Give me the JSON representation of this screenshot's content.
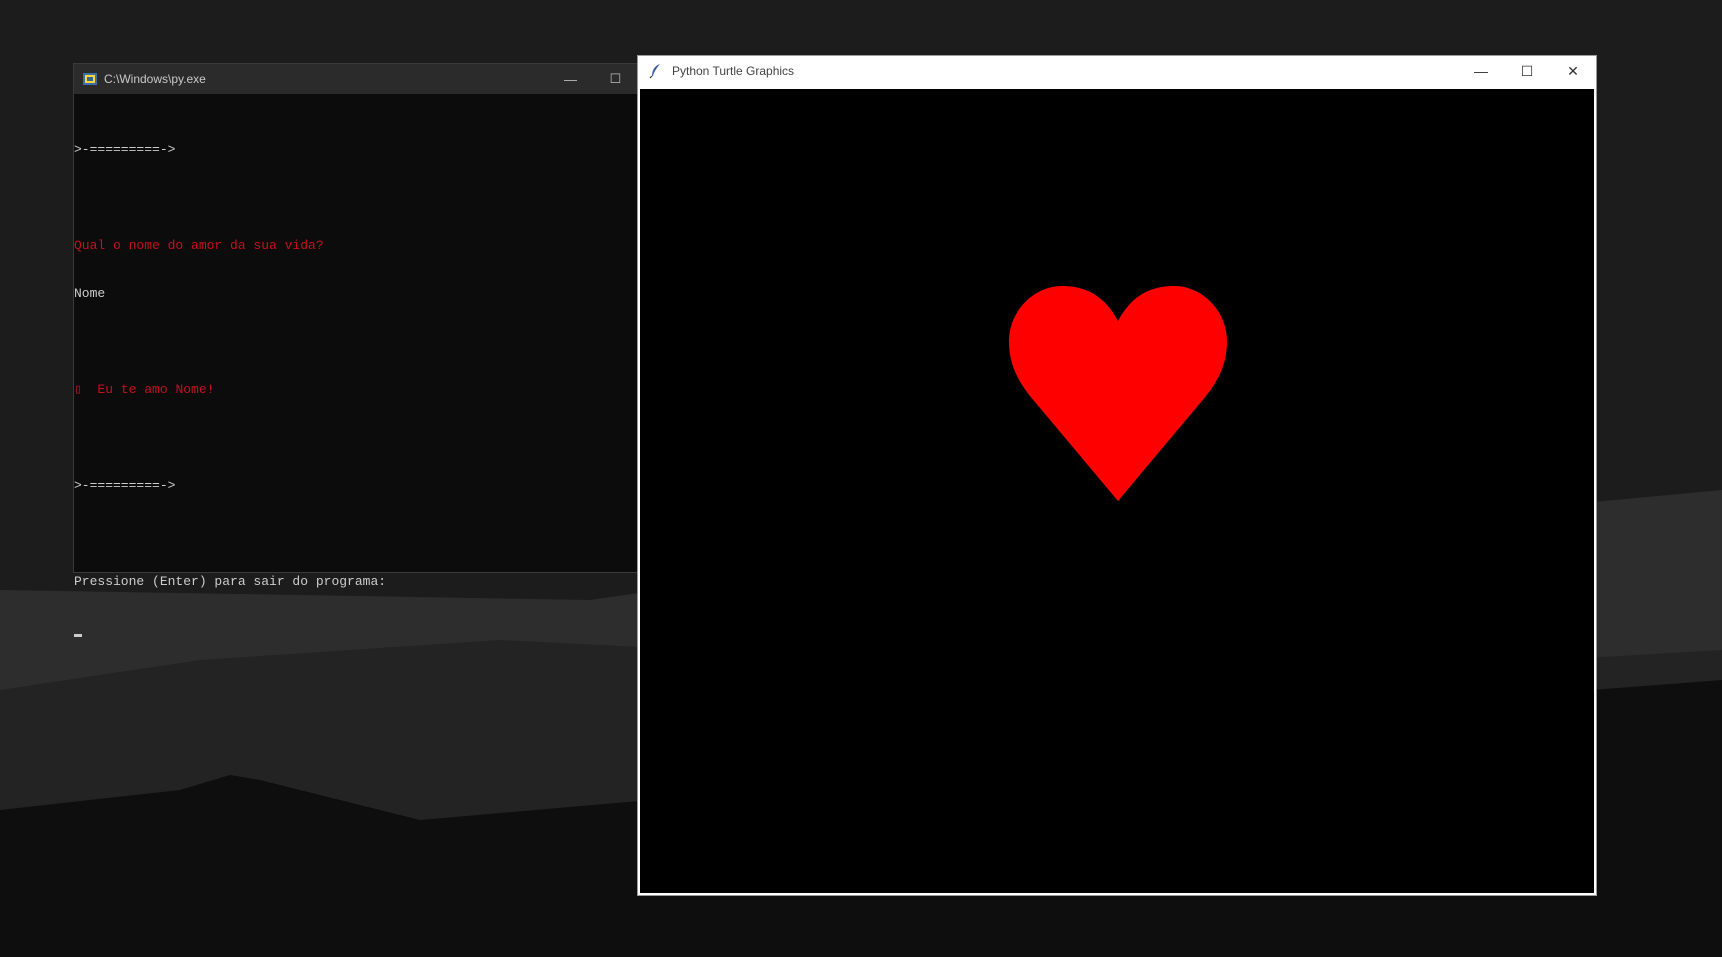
{
  "console": {
    "title": "C:\\Windows\\py.exe",
    "lines": {
      "l1": ">-=========->",
      "l2": "Qual o nome do amor da sua vida?",
      "l3": "Nome",
      "l4": "▯  Eu te amo Nome!",
      "l5": ">-=========->",
      "l6": "Pressione (Enter) para sair do programa:"
    },
    "controls": {
      "minimize": "—",
      "maximize": "☐"
    },
    "icon": "python-console-icon"
  },
  "turtle_window": {
    "title": "Python Turtle Graphics",
    "icon": "feather-icon",
    "controls": {
      "minimize": "—",
      "maximize": "☐",
      "close": "✕"
    },
    "canvas_background": "#000000",
    "shape": {
      "type": "heart",
      "color": "#ff0000"
    }
  },
  "colors": {
    "console_background": "#0c0c0c",
    "console_text": "#cccccc",
    "console_red": "#c50f1f"
  }
}
